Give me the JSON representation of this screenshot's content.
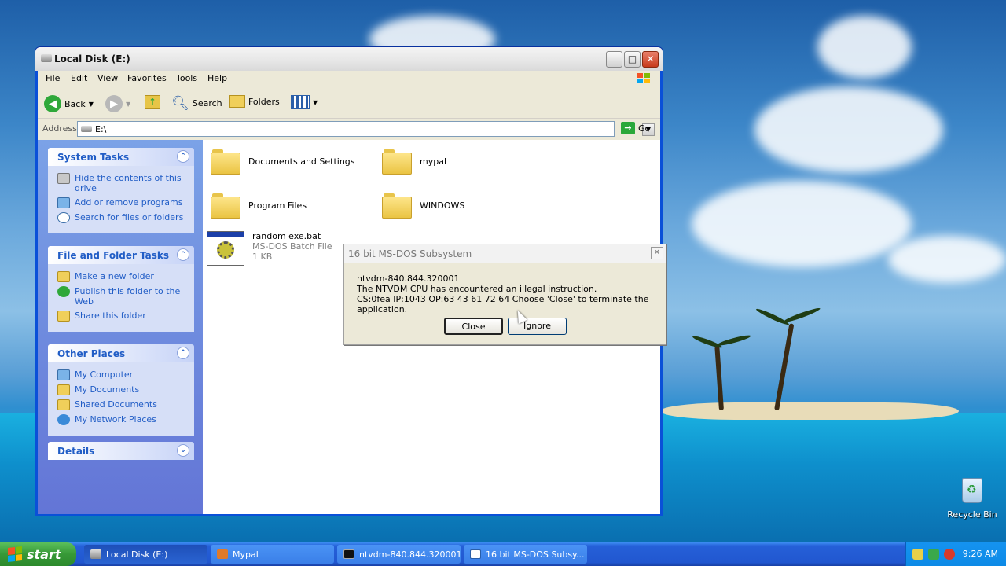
{
  "window": {
    "title": "Local Disk (E:)",
    "controls": {
      "minimize": "_",
      "maximize": "□",
      "close": "✕"
    }
  },
  "menu": [
    "File",
    "Edit",
    "View",
    "Favorites",
    "Tools",
    "Help"
  ],
  "toolbar": {
    "back_label": "Back",
    "search_label": "Search",
    "folders_label": "Folders"
  },
  "address": {
    "label": "Address",
    "value": "E:\\",
    "go_label": "Go"
  },
  "taskpane": {
    "system_tasks": {
      "title": "System Tasks",
      "items": [
        "Hide the contents of this drive",
        "Add or remove programs",
        "Search for files or folders"
      ]
    },
    "file_folder_tasks": {
      "title": "File and Folder Tasks",
      "items": [
        "Make a new folder",
        "Publish this folder to the Web",
        "Share this folder"
      ]
    },
    "other_places": {
      "title": "Other Places",
      "items": [
        "My Computer",
        "My Documents",
        "Shared Documents",
        "My Network Places"
      ]
    },
    "details": {
      "title": "Details"
    }
  },
  "files": {
    "folders": [
      "Documents and Settings",
      "mypal",
      "Program Files",
      "WINDOWS"
    ],
    "bat": {
      "name": "random exe.bat",
      "type": "MS-DOS Batch File",
      "size": "1 KB"
    }
  },
  "dialog": {
    "title": "16 bit MS-DOS Subsystem",
    "line1": "ntvdm-840.844.320001",
    "line2": "The NTVDM CPU has encountered an illegal instruction.",
    "line3": "CS:0fea IP:1043 OP:63 43 61 72 64 Choose 'Close' to terminate the application.",
    "close_label": "Close",
    "ignore_label": "Ignore"
  },
  "desktop": {
    "recycle_bin": "Recycle Bin"
  },
  "taskbar": {
    "start_label": "start",
    "buttons": [
      "Local Disk (E:)",
      "Mypal",
      "ntvdm-840.844.320001",
      "16 bit MS-DOS Subsy..."
    ],
    "clock": "9:26 AM"
  },
  "colors": {
    "taskbar": "#2157d0",
    "start_green": "#379937",
    "link_blue": "#215dc6"
  }
}
